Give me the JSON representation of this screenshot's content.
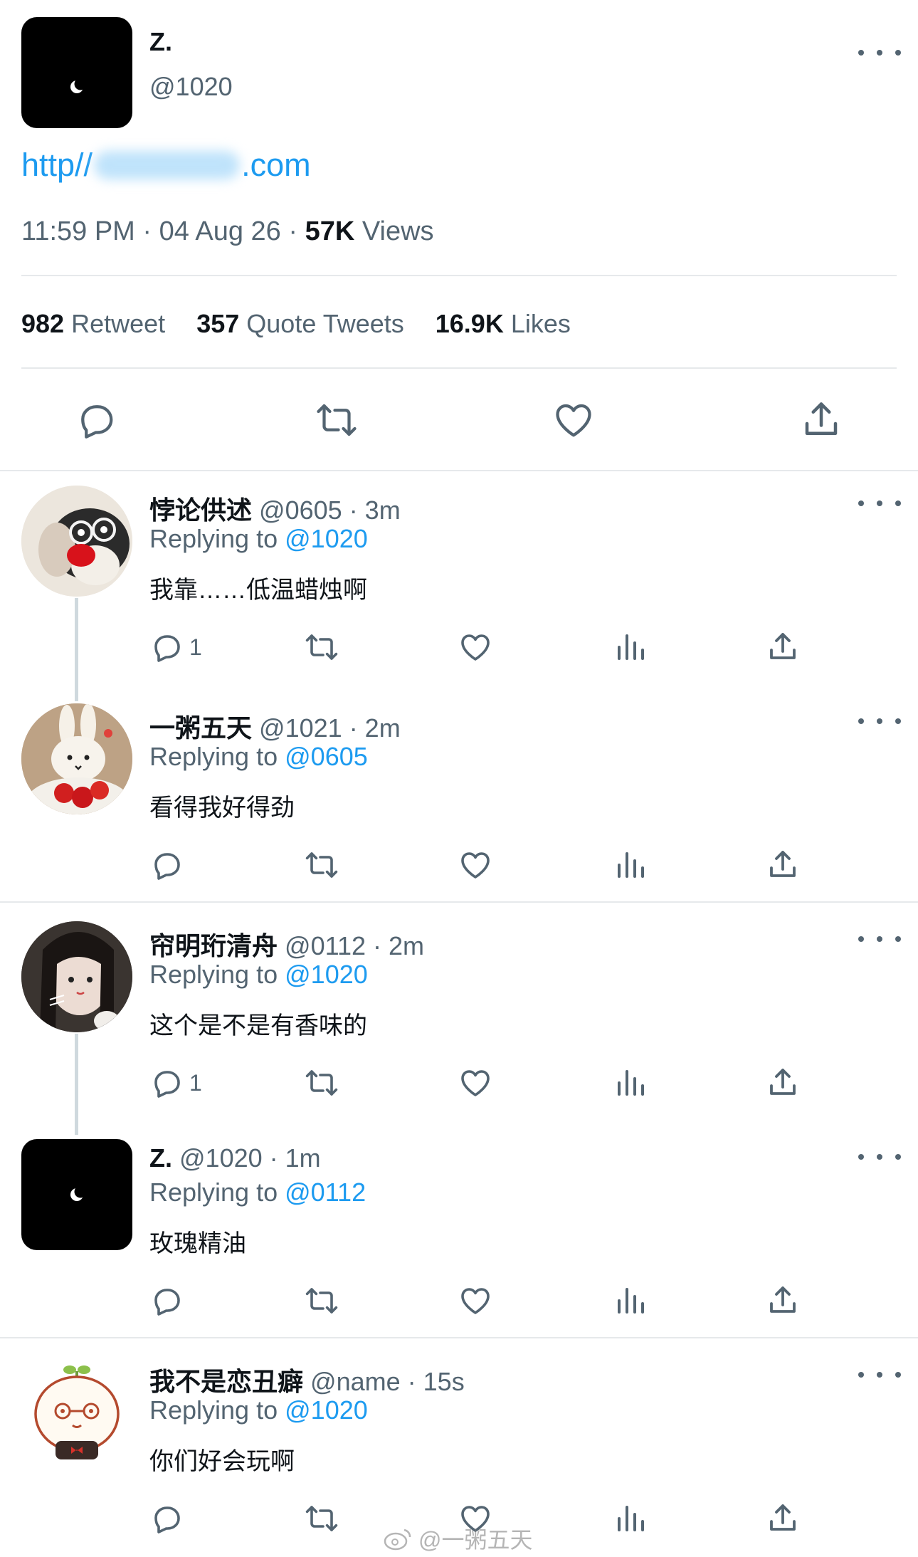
{
  "main_tweet": {
    "display_name": "Z.",
    "handle": "@1020",
    "link_prefix": "http//",
    "link_suffix": ".com",
    "time": "11:59 PM",
    "date": "04 Aug 26",
    "views_count": "57K",
    "views_label": "Views",
    "separator": "·",
    "retweet_count": "982",
    "retweet_label": "Retweet",
    "quote_count": "357",
    "quote_label": "Quote Tweets",
    "likes_count": "16.9K",
    "likes_label": "Likes"
  },
  "replies": [
    {
      "display_name": "悖论供述",
      "handle": "@0605",
      "time": "· 3m",
      "replying_label": "Replying to",
      "replying_to": "@1020",
      "text": "我靠……低温蜡烛啊",
      "reply_count": "1"
    },
    {
      "display_name": "一粥五天",
      "handle": "@1021",
      "time": "· 2m",
      "replying_label": "Replying to",
      "replying_to": "@0605",
      "text": "看得我好得劲",
      "reply_count": ""
    },
    {
      "display_name": "帘明珩清舟",
      "handle": "@0112",
      "time": "· 2m",
      "replying_label": "Replying to",
      "replying_to": "@1020",
      "text": "这个是不是有香味的",
      "reply_count": "1"
    },
    {
      "display_name": "Z.",
      "handle": "@1020",
      "time": "· 1m",
      "replying_label": "Replying to",
      "replying_to": "@0112",
      "text": "玫瑰精油",
      "reply_count": ""
    },
    {
      "display_name": "我不是恋丑癖",
      "handle": "@name",
      "time": "· 15s",
      "replying_label": "Replying to",
      "replying_to": "@1020",
      "text": "你们好会玩啊",
      "reply_count": ""
    }
  ],
  "watermark": "@一粥五天",
  "colors": {
    "accent": "#1d9bf0",
    "muted": "#536471",
    "text": "#0f1419",
    "divider": "#e6e9eb"
  }
}
